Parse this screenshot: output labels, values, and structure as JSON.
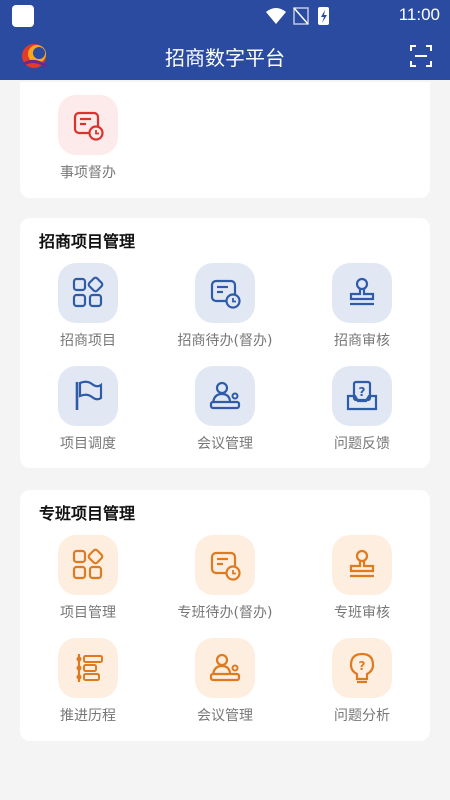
{
  "status": {
    "time": "11:00"
  },
  "app": {
    "title": "招商数字平台"
  },
  "section0": {
    "items": [
      {
        "label": "事项督办",
        "icon": "clock-doc-icon"
      }
    ]
  },
  "section1": {
    "title": "招商项目管理",
    "items": [
      {
        "label": "招商项目",
        "icon": "apps-grid-icon"
      },
      {
        "label": "招商待办(督办)",
        "icon": "clock-doc-icon"
      },
      {
        "label": "招商审核",
        "icon": "stamp-icon"
      },
      {
        "label": "项目调度",
        "icon": "flag-icon"
      },
      {
        "label": "会议管理",
        "icon": "meeting-icon"
      },
      {
        "label": "问题反馈",
        "icon": "question-inbox-icon"
      }
    ]
  },
  "section2": {
    "title": "专班项目管理",
    "items": [
      {
        "label": "项目管理",
        "icon": "apps-grid-icon"
      },
      {
        "label": "专班待办(督办)",
        "icon": "clock-doc-icon"
      },
      {
        "label": "专班审核",
        "icon": "stamp-icon"
      },
      {
        "label": "推进历程",
        "icon": "timeline-icon"
      },
      {
        "label": "会议管理",
        "icon": "meeting-icon"
      },
      {
        "label": "问题分析",
        "icon": "question-bulb-icon"
      }
    ]
  },
  "colors": {
    "primary": "#2a4ba0",
    "blue_icon": "#2f5ca8",
    "orange_icon": "#e07a1f",
    "red_icon": "#d9342b"
  }
}
